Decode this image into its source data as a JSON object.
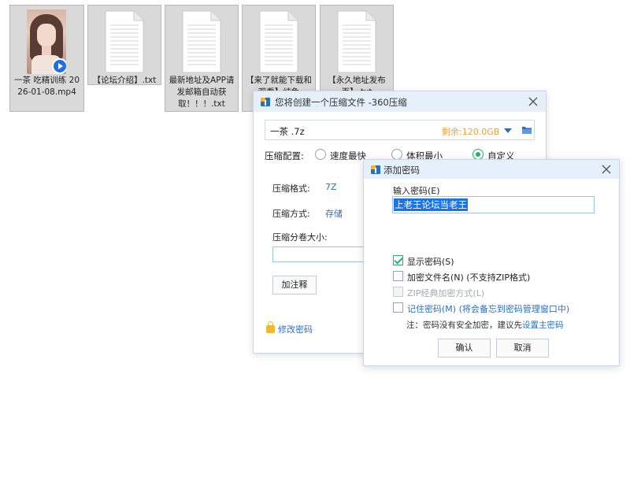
{
  "desktop": {
    "files": [
      {
        "label": "一茶 吃精训练 2026-01-08.mp4",
        "type": "video"
      },
      {
        "label": "【论坛介绍】.txt",
        "type": "txt"
      },
      {
        "label": "最新地址及APP请发邮箱自动获取！！！.txt",
        "type": "txt"
      },
      {
        "label": "【来了就能下载和观看】纯免",
        "type": "txt"
      },
      {
        "label": "【永久地址发布页】.txt",
        "type": "txt"
      }
    ]
  },
  "compress_dialog": {
    "title": "您将创建一个压缩文件 -360压缩",
    "archive_name": "一茶 .7z",
    "free_space": "剩余:120.0GB",
    "config_label": "压缩配置:",
    "options": [
      "速度最快",
      "体积最小",
      "自定义"
    ],
    "selected_option": "自定义",
    "format_label": "压缩格式:",
    "format_value": "7Z",
    "method_label": "压缩方式:",
    "method_value": "存储",
    "volume_label": "压缩分卷大小:",
    "volume_value": "",
    "comment_button": "加注释",
    "modify_password": "修改密码"
  },
  "password_dialog": {
    "title": "添加密码",
    "input_label": "输入密码(E)",
    "password_value": "上老王论坛当老王",
    "checkboxes": [
      {
        "label": "显示密码(S)",
        "checked": true,
        "enabled": true
      },
      {
        "label": "加密文件名(N) (不支持ZIP格式)",
        "checked": false,
        "enabled": true
      },
      {
        "label": "ZIP经典加密方式(L)",
        "checked": false,
        "enabled": false
      },
      {
        "label": "记住密码(M) (将会备忘到密码管理窗口中)",
        "checked": false,
        "enabled": true
      }
    ],
    "note_prefix": "注：密码没有安全加密，建议先",
    "note_link": "设置主密码",
    "ok_button": "确认",
    "cancel_button": "取消"
  },
  "colors": {
    "accent_blue": "#2b6fc2",
    "check_green": "#27b36a",
    "free_space_orange": "#e6a23c",
    "title_bar": "#e6f0fb"
  }
}
